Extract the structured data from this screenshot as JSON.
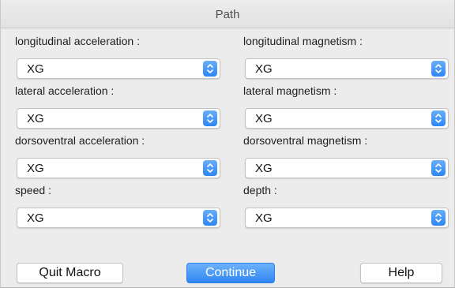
{
  "window": {
    "title": "Path"
  },
  "fields": {
    "left": [
      {
        "label": "longitudinal acceleration :",
        "value": "XG"
      },
      {
        "label": "lateral acceleration :",
        "value": "XG"
      },
      {
        "label": "dorsoventral acceleration :",
        "value": "XG"
      },
      {
        "label": "speed :",
        "value": "XG"
      }
    ],
    "right": [
      {
        "label": "longitudinal magnetism :",
        "value": "XG"
      },
      {
        "label": "lateral magnetism :",
        "value": "XG"
      },
      {
        "label": "dorsoventral magnetism :",
        "value": "XG"
      },
      {
        "label": "depth :",
        "value": "XG"
      }
    ]
  },
  "buttons": {
    "quit": "Quit Macro",
    "continue": "Continue",
    "help": "Help"
  },
  "icons": {
    "select_stepper": "up-down-chevron-icon"
  },
  "colors": {
    "accent": "#2f86f3",
    "window_bg": "#ececec"
  }
}
